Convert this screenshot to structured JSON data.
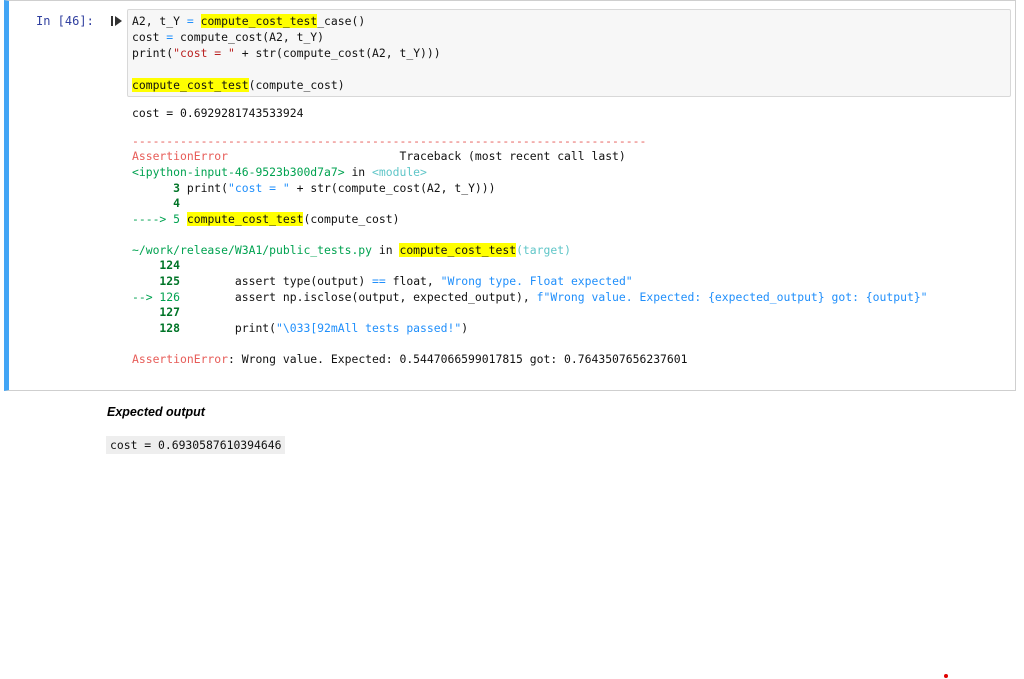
{
  "cell": {
    "prompt": "In [46]:",
    "code": {
      "line1_a": "A2, t_Y ",
      "line1_eq": "=",
      "line1_sp": " ",
      "line1_fn": "compute_cost_test",
      "line1_b": "_case()",
      "line2_a": "cost ",
      "line2_eq": "=",
      "line2_b": " compute_cost(A2, t_Y)",
      "line3_a": "print(",
      "line3_str": "\"cost = \"",
      "line3_b": " + str(compute_cost(A2, t_Y)))",
      "line5_fn": "compute_cost_test",
      "line5_b": "(compute_cost)"
    },
    "output": {
      "stdout": "cost = 0.6929281743533924",
      "dashes": "---------------------------------------------------------------------------",
      "error_name": "AssertionError",
      "traceback_label": "Traceback (most recent call last)",
      "input_ref": "<ipython-input-46-9523b300d7a7>",
      "in_word": " in ",
      "module": "<module>",
      "tb1_num": "      3 ",
      "tb1_a": "print(",
      "tb1_str": "\"cost = \"",
      "tb1_b": " + str(compute_cost(A2, t_Y)))",
      "tb2_num": "      4",
      "tb3_arrow": "----> 5 ",
      "tb3_fn": "compute_cost_test",
      "tb3_b": "(compute_cost)",
      "file_path": "~/work/release/W3A1/public_tests.py",
      "file_in": " in ",
      "file_fn": "compute_cost_test",
      "file_target": "(target)",
      "l124": "    124",
      "l125": "    125",
      "l125_code_a": "        assert type(output) ",
      "l125_eq": "==",
      "l125_code_b": " float, ",
      "l125_str": "\"Wrong type. Float expected\"",
      "l126": "--> 126",
      "l126_code_a": "        assert np.isclose(output, expected_output), ",
      "l126_str": "f\"Wrong value. Expected: {expected_output} got: {output}\"",
      "l127": "    127",
      "l128": "    128",
      "l128_code_a": "        print(",
      "l128_str": "\"\\033[92mAll tests passed!\"",
      "l128_code_b": ")",
      "final_err_name": "AssertionError",
      "final_err_msg": ": Wrong value. Expected: 0.5447066599017815 got: 0.7643507656237601"
    }
  },
  "expected": {
    "title": "Expected output",
    "value": "cost = 0.6930587610394646"
  },
  "colors": {
    "cell_accent": "#42a5f5",
    "highlight": "#ffff00",
    "error_red": "#e75c58"
  },
  "icons": {
    "run": "run-cell-icon"
  }
}
